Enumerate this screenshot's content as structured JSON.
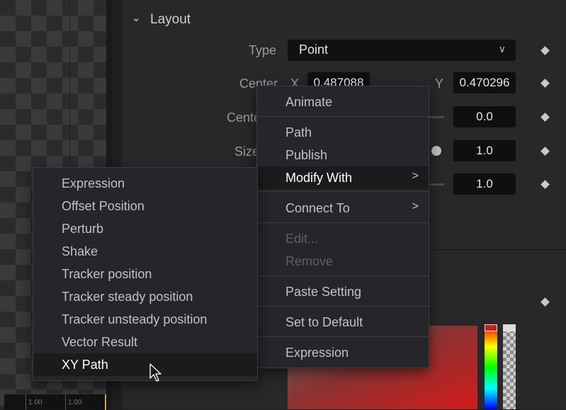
{
  "layout_section": {
    "title": "Layout",
    "type_label": "Type",
    "type_value": "Point",
    "center_label": "Center",
    "center_x_label": "X",
    "center_x_value": "0.487088",
    "center_y_label": "Y",
    "center_y_value": "0.470296",
    "center_z_label": "Center Z",
    "center_z_value": "0.0",
    "size_label": "Size",
    "size_value": "1.0",
    "angle_value": "1.0"
  },
  "context_menu": {
    "items": [
      {
        "label": "Animate",
        "disabled": false
      },
      {
        "label": "Path",
        "disabled": false
      },
      {
        "label": "Publish",
        "disabled": false
      },
      {
        "label": "Modify With",
        "disabled": false,
        "submenu": true
      },
      {
        "label": "Connect To",
        "disabled": false,
        "submenu": true
      },
      {
        "label": "Edit...",
        "disabled": true
      },
      {
        "label": "Remove",
        "disabled": true
      },
      {
        "label": "Paste Setting",
        "disabled": false
      },
      {
        "label": "Set to Default",
        "disabled": false
      },
      {
        "label": "Expression",
        "disabled": false
      }
    ]
  },
  "modify_with_submenu": {
    "items": [
      "Expression",
      "Offset Position",
      "Perturb",
      "Shake",
      "Tracker position",
      "Tracker steady position",
      "Tracker unsteady position",
      "Vector Result",
      "XY Path"
    ],
    "hovered": "XY Path"
  },
  "ruler": {
    "labels": [
      "1.00",
      "1.00"
    ]
  },
  "icons": {
    "section": "chevron-down-icon",
    "dropdown": "chevron-down-icon",
    "keyframe": "diamond-icon",
    "submenu": "chevron-right-icon",
    "cursor": "mouse-pointer-icon"
  },
  "colors": {
    "accent_playhead": "#d6a43a",
    "color_swatch": "#d31a1a"
  }
}
